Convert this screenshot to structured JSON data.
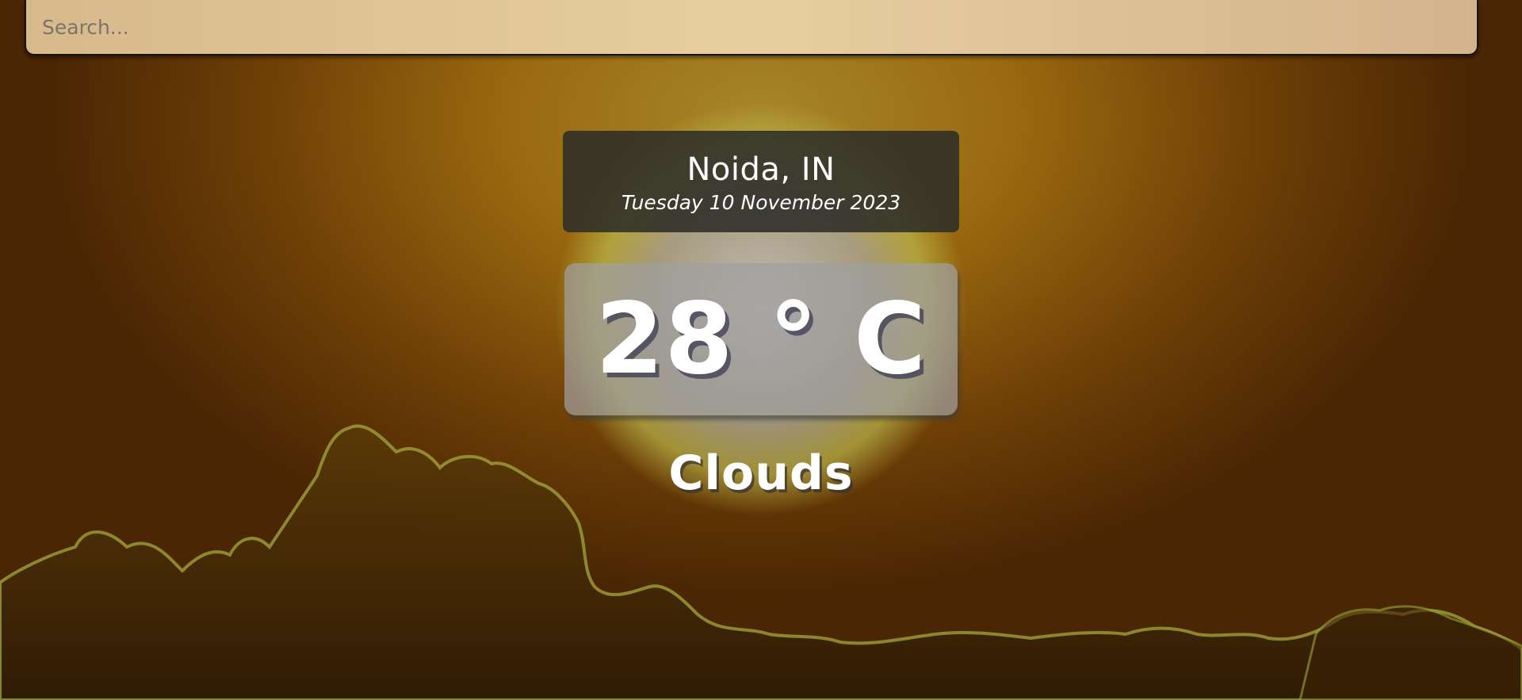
{
  "search": {
    "placeholder": "Search..."
  },
  "weather": {
    "location": "Noida, IN",
    "date": "Tuesday 10 November 2023",
    "temperature": "28 ° C",
    "condition": "Clouds"
  },
  "colors": {
    "background_warm": "#9a6a10",
    "background_dark": "#4a2604",
    "sun_glow": "#c8c8d2",
    "search_bg": "#e6cf9f",
    "card_dark": "#2d2d28",
    "card_light": "#a0a0a0",
    "cloud_edge": "#9aa63a"
  },
  "icons": {
    "background": "sunset-clouds-image"
  }
}
